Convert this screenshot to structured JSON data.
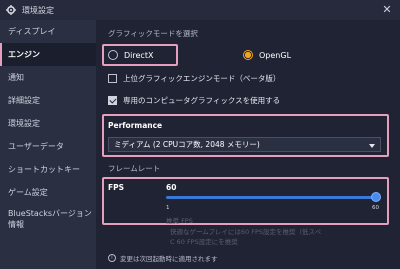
{
  "window": {
    "title": "環境設定",
    "close_glyph": "✕"
  },
  "sidebar": {
    "items": [
      {
        "label": "ディスプレイ"
      },
      {
        "label": "エンジン"
      },
      {
        "label": "通知"
      },
      {
        "label": "詳細設定"
      },
      {
        "label": "環境設定"
      },
      {
        "label": "ユーザーデータ"
      },
      {
        "label": "ショートカットキー"
      },
      {
        "label": "ゲーム設定"
      },
      {
        "label": "BlueStacksバージョン情報"
      }
    ],
    "active_index": 1
  },
  "graphics_mode": {
    "label": "グラフィックモードを選択",
    "options": [
      {
        "label": "DirectX",
        "selected": false
      },
      {
        "label": "OpenGL",
        "selected": true
      }
    ]
  },
  "checkboxes": [
    {
      "label": "上位グラフィックエンジンモード（ベータ版）",
      "checked": false
    },
    {
      "label": "専用のコンピュータグラフィックスを使用する",
      "checked": true
    }
  ],
  "performance": {
    "label": "Performance",
    "selected": "ミディアム (2 CPUコア数, 2048 メモリー)"
  },
  "frame_rate": {
    "label": "フレームレート",
    "fps_label": "FPS",
    "fps_value": "60",
    "min": "1",
    "max": "60",
    "value": 60
  },
  "hint_text": {
    "line1": "推奨 FPS",
    "line2": "快適なゲームプレイには60 FPS設定を推奨（低スペ",
    "line3": "C 60 FPS設定にを推奨"
  },
  "footer": {
    "text": "変更は次回起動時に適用されます",
    "icon": "info-icon"
  },
  "colors": {
    "accent": "#f0a321",
    "highlight": "#e59ebb",
    "slider": "#3a78d8"
  }
}
